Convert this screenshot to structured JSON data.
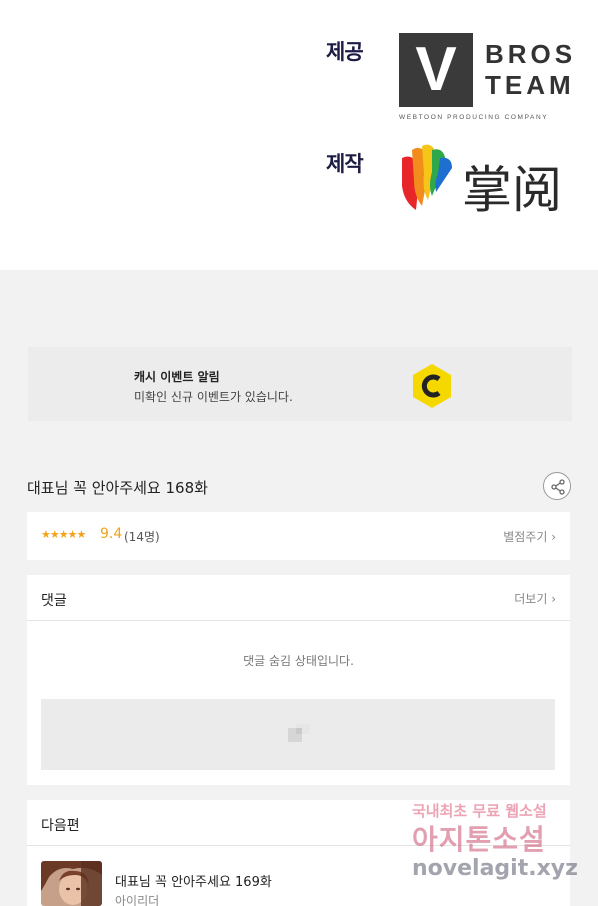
{
  "credits": {
    "provider_label": "제공",
    "producer_label": "제작",
    "provider_logo": {
      "letter": "V",
      "line1": "BROS",
      "line2": "TEAM",
      "tagline": "WEBTOON PRODUCING COMPANY"
    },
    "producer_logo": {
      "text": "掌阅"
    }
  },
  "cash_event": {
    "title": "캐시 이벤트 알림",
    "description": "미확인 신규 이벤트가 있습니다.",
    "icon": "cash-coin-icon",
    "icon_color": "#f5d800"
  },
  "episode": {
    "title": "대표님 꼭 안아주세요 168화",
    "share_icon": "share-icon"
  },
  "rating": {
    "stars": "★★★★★",
    "score": "9.4",
    "count": "(14명)",
    "rate_label": "별점주기 ›",
    "accent_color": "#f2a31b"
  },
  "comments": {
    "title": "댓글",
    "more_label": "더보기 ›",
    "hidden_message": "댓글 숨김 상태입니다."
  },
  "next_episode": {
    "section_title": "다음편",
    "title": "대표님 꼭 안아주세요 169화",
    "author": "아이리더"
  },
  "watermark": {
    "line1": "국내최초 무료 웹소설",
    "line2": "아지톤소설",
    "line3": "novelagit.xyz"
  }
}
